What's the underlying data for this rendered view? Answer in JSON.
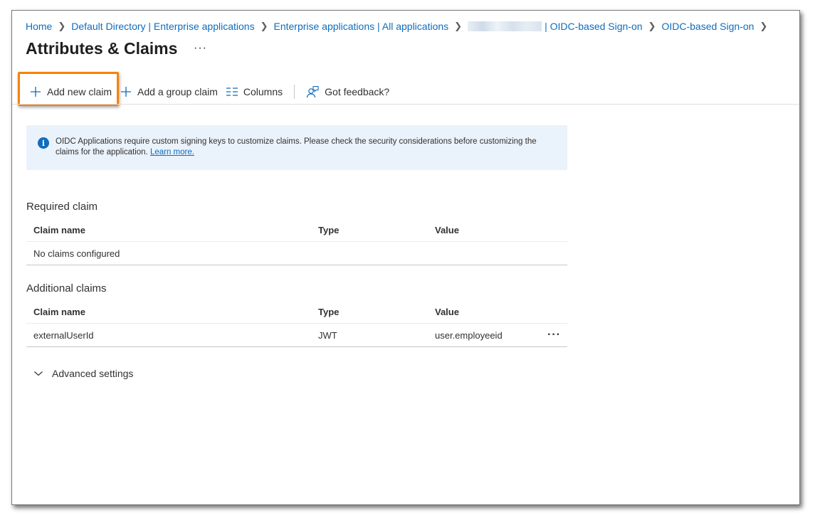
{
  "breadcrumb": {
    "items": [
      "Home",
      "Default Directory | Enterprise applications",
      "Enterprise applications | All applications",
      "| OIDC-based Sign-on",
      "OIDC-based Sign-on"
    ]
  },
  "page": {
    "title": "Attributes & Claims",
    "more": "···"
  },
  "toolbar": {
    "add_new_claim": "Add new claim",
    "add_group_claim": "Add a group claim",
    "columns": "Columns",
    "feedback": "Got feedback?"
  },
  "info": {
    "text": "OIDC Applications require custom signing keys to customize claims. Please check the security considerations before customizing the claims for the application. ",
    "link": "Learn more."
  },
  "required": {
    "title": "Required claim",
    "headers": [
      "Claim name",
      "Type",
      "Value"
    ],
    "empty": "No claims configured"
  },
  "additional": {
    "title": "Additional claims",
    "headers": [
      "Claim name",
      "Type",
      "Value"
    ],
    "rows": [
      {
        "name": "externalUserId",
        "type": "JWT",
        "value": "user.employeeid"
      }
    ],
    "row_more": "···"
  },
  "advanced": {
    "label": "Advanced settings"
  },
  "colors": {
    "accent": "#0f6cbd",
    "highlight": "#f7820a",
    "info_bg": "#eaf2fb"
  }
}
